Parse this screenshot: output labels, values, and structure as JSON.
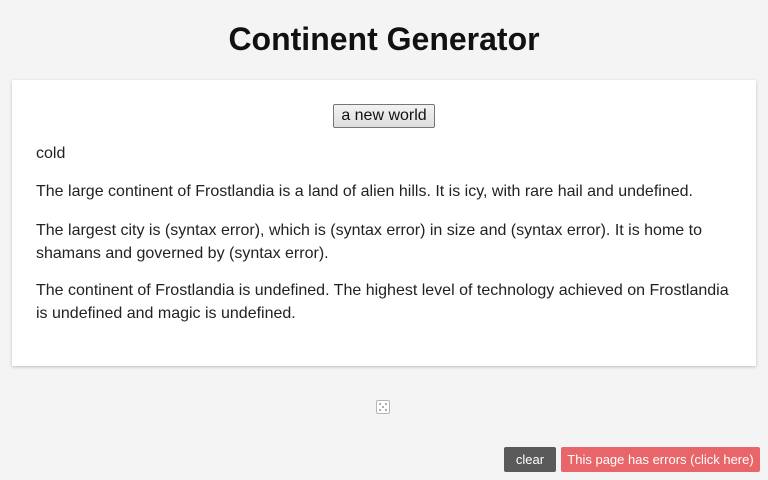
{
  "page": {
    "title": "Continent Generator"
  },
  "generator": {
    "button_label": "a new world"
  },
  "output": {
    "paragraphs": [
      "cold",
      "The large continent of Frostlandia is a land of alien hills. It is icy, with rare hail and undefined.",
      "The largest city is (syntax error), which is (syntax error) in size and (syntax error). It is home to shamans and governed by (syntax error).",
      "The continent of Frostlandia is undefined. The highest level of technology achieved on Frostlandia is undefined and magic is undefined."
    ]
  },
  "footer": {
    "dice_icon": "dice-five-icon",
    "clear_label": " clear",
    "error_label": "This page has errors (click here)"
  },
  "colors": {
    "background": "#f4f4f4",
    "card": "#ffffff",
    "clear_button": "#5a5a5a",
    "error_button": "#e8656a"
  }
}
